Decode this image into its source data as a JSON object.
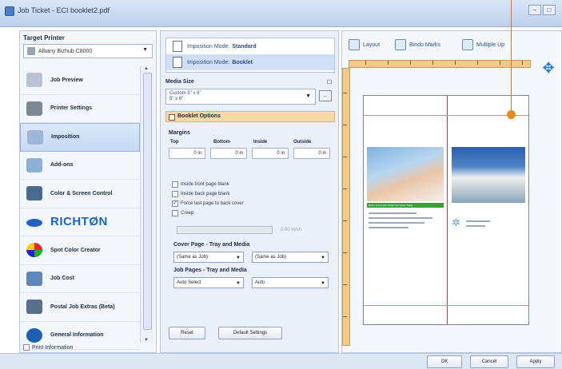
{
  "window": {
    "title": "Job Ticket - ECI booklet2.pdf",
    "controls": [
      "–",
      "□"
    ]
  },
  "left_panel": {
    "target_printer_label": "Target Printer",
    "printer_value": "Albany Bizhub C8000",
    "nav_items": [
      {
        "label": "Job Preview",
        "icon": "job-preview-icon",
        "color": "#b8c4d4"
      },
      {
        "label": "Printer Settings",
        "icon": "printer-icon",
        "color": "#7d8896"
      },
      {
        "label": "Imposition",
        "icon": "imposition-icon",
        "color": "#9fb6d8"
      },
      {
        "label": "Add-ons",
        "icon": "add-ons-icon",
        "color": "#8fb0d6"
      },
      {
        "label": "Color & Screen Control",
        "icon": "color-screen-icon",
        "color": "#4a6a8e"
      },
      {
        "label": "RICHTØN",
        "icon": "richton-icon",
        "color": "#1e63c4"
      },
      {
        "label": "Spot Color Creator",
        "icon": "spot-color-icon",
        "color": "#e0b030"
      },
      {
        "label": "Job Cost",
        "icon": "job-cost-icon",
        "color": "#5f87bb"
      },
      {
        "label": "Postal Job Extras (Beta)",
        "icon": "postal-icon",
        "color": "#5a6f90"
      },
      {
        "label": "General Information",
        "icon": "info-icon",
        "color": "#1f5fb0"
      }
    ],
    "active_index": 2,
    "print_information": "Print Information"
  },
  "middle_panel": {
    "imposition_modes": [
      {
        "label": "Imposition Mode:",
        "value": "Standard"
      },
      {
        "label": "Imposition Mode:",
        "value": "Booklet"
      }
    ],
    "media_size_label": "Media Size",
    "media_size_value_line1": "Custom 5\" x 6\"",
    "media_size_value_line2": "5\" x 6\"",
    "media_button": "...",
    "booklet_options_label": "Booklet Options",
    "margins_label": "Margins",
    "margin_columns": [
      "Top",
      "Bottom",
      "Inside",
      "Outside"
    ],
    "margin_values": [
      "0 in",
      "0 in",
      "0 in",
      "0 in"
    ],
    "checkboxes": [
      {
        "label": "Inside front page blank",
        "checked": false
      },
      {
        "label": "Inside back page blank",
        "checked": false
      },
      {
        "label": "Force last page to back cover",
        "checked": true
      },
      {
        "label": "Creep",
        "checked": false
      }
    ],
    "creep_value": "0.00 in/sh",
    "cover_page_label": "Cover Page - Tray and Media",
    "cover_combo_1": "(Same as Job)",
    "cover_combo_2": "(Same as Job)",
    "job_pages_label": "Job Pages - Tray and Media",
    "job_combo_1": "Auto Select",
    "job_combo_2": "Auto",
    "reset_button": "Reset",
    "default_settings_button": "Default Settings"
  },
  "right_panel": {
    "toolbar": [
      {
        "label": "Layout",
        "icon": "layout-icon"
      },
      {
        "label": "Bindo Marks",
        "icon": "bind-marks-icon"
      },
      {
        "label": "Multiple Up",
        "icon": "multiple-up-icon"
      }
    ],
    "preview_page_label": "Better Living with Pacific Sun Solar Today",
    "pan_icon": "move-arrows-icon"
  },
  "footer": {
    "ok_button": "OK",
    "cancel_button": "Cancel",
    "apply_button": "Apply"
  },
  "colors": {
    "accent_orange": "#e98a1e",
    "booklet_header": "#f7d9a3",
    "ruler": "#f0c98b",
    "fold_line": "#c9363c"
  }
}
